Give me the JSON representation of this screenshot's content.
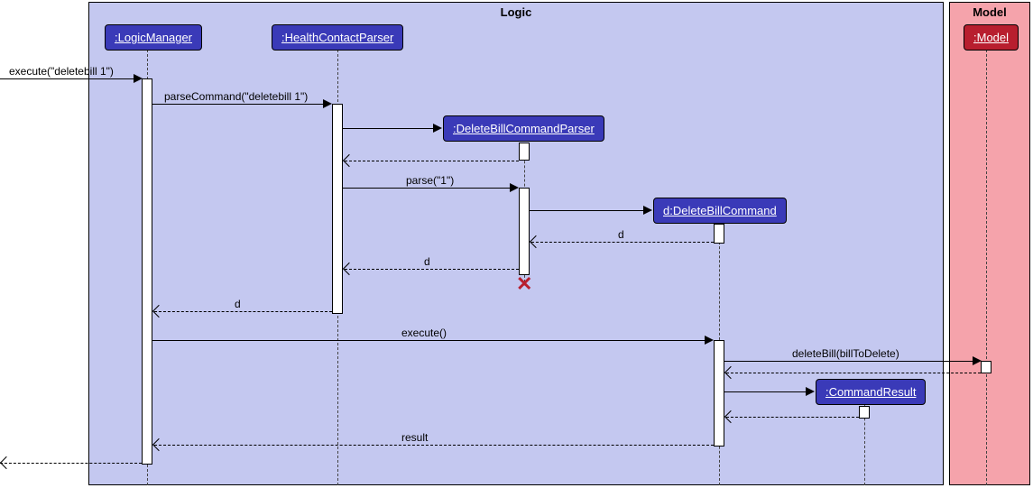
{
  "frames": {
    "logic": "Logic",
    "model": "Model"
  },
  "participants": {
    "logicManager": ":LogicManager",
    "healthContactParser": ":HealthContactParser",
    "deleteBillCommandParser": ":DeleteBillCommandParser",
    "deleteBillCommand": "d:DeleteBillCommand",
    "commandResult": ":CommandResult",
    "model": ":Model"
  },
  "messages": {
    "execute1": "execute(\"deletebill 1\")",
    "parseCommand": "parseCommand(\"deletebill 1\")",
    "parse": "parse(\"1\")",
    "d1": "d",
    "d2": "d",
    "d3": "d",
    "execute2": "execute()",
    "deleteBill": "deleteBill(billToDelete)",
    "result": "result"
  },
  "chart_data": {
    "type": "sequence_diagram",
    "frames": [
      {
        "name": "Logic",
        "participants": [
          ":LogicManager",
          ":HealthContactParser",
          ":DeleteBillCommandParser",
          "d:DeleteBillCommand",
          ":CommandResult"
        ]
      },
      {
        "name": "Model",
        "participants": [
          ":Model"
        ]
      }
    ],
    "participants": [
      ":LogicManager",
      ":HealthContactParser",
      ":DeleteBillCommandParser",
      "d:DeleteBillCommand",
      ":CommandResult",
      ":Model"
    ],
    "messages": [
      {
        "from": "caller",
        "to": ":LogicManager",
        "label": "execute(\"deletebill 1\")",
        "type": "sync"
      },
      {
        "from": ":LogicManager",
        "to": ":HealthContactParser",
        "label": "parseCommand(\"deletebill 1\")",
        "type": "sync"
      },
      {
        "from": ":HealthContactParser",
        "to": ":DeleteBillCommandParser",
        "label": "",
        "type": "create"
      },
      {
        "from": ":DeleteBillCommandParser",
        "to": ":HealthContactParser",
        "label": "",
        "type": "return"
      },
      {
        "from": ":HealthContactParser",
        "to": ":DeleteBillCommandParser",
        "label": "parse(\"1\")",
        "type": "sync"
      },
      {
        "from": ":DeleteBillCommandParser",
        "to": "d:DeleteBillCommand",
        "label": "",
        "type": "create"
      },
      {
        "from": "d:DeleteBillCommand",
        "to": ":DeleteBillCommandParser",
        "label": "d",
        "type": "return"
      },
      {
        "from": ":DeleteBillCommandParser",
        "to": ":HealthContactParser",
        "label": "d",
        "type": "return"
      },
      {
        "from": ":DeleteBillCommandParser",
        "to": "",
        "label": "",
        "type": "destroy"
      },
      {
        "from": ":HealthContactParser",
        "to": ":LogicManager",
        "label": "d",
        "type": "return"
      },
      {
        "from": ":LogicManager",
        "to": "d:DeleteBillCommand",
        "label": "execute()",
        "type": "sync"
      },
      {
        "from": "d:DeleteBillCommand",
        "to": ":Model",
        "label": "deleteBill(billToDelete)",
        "type": "sync"
      },
      {
        "from": ":Model",
        "to": "d:DeleteBillCommand",
        "label": "",
        "type": "return"
      },
      {
        "from": "d:DeleteBillCommand",
        "to": ":CommandResult",
        "label": "",
        "type": "create"
      },
      {
        "from": ":CommandResult",
        "to": "d:DeleteBillCommand",
        "label": "",
        "type": "return"
      },
      {
        "from": "d:DeleteBillCommand",
        "to": ":LogicManager",
        "label": "result",
        "type": "return"
      },
      {
        "from": ":LogicManager",
        "to": "caller",
        "label": "",
        "type": "return"
      }
    ]
  }
}
